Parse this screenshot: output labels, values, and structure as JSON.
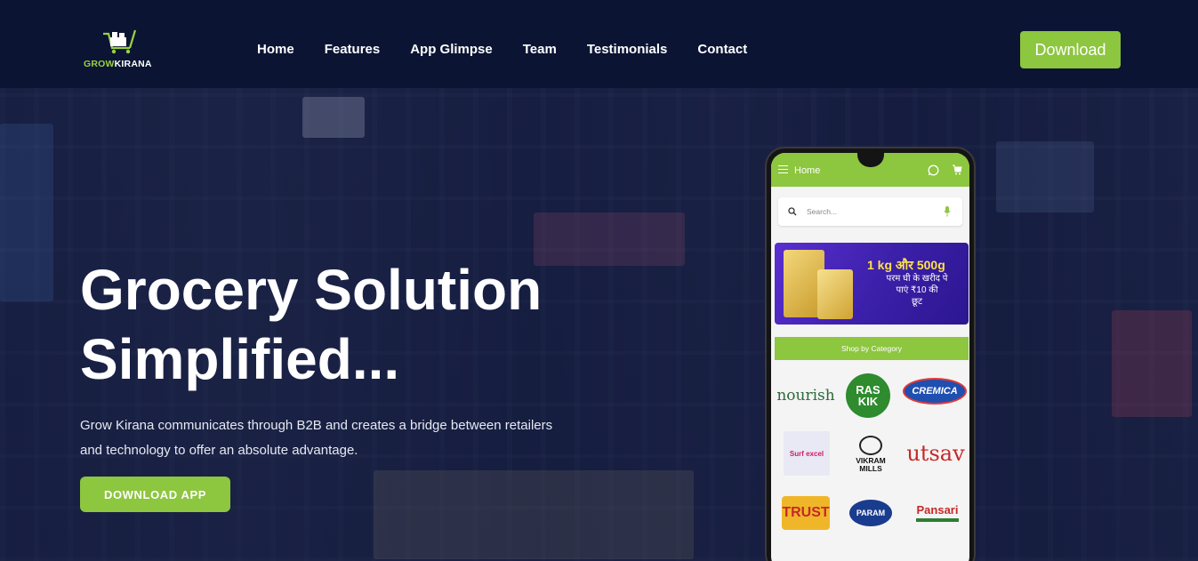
{
  "brand": {
    "logo_part1": "GROW",
    "logo_part2": "KIRANA"
  },
  "nav": {
    "links": [
      "Home",
      "Features",
      "App Glimpse",
      "Team",
      "Testimonials",
      "Contact"
    ],
    "download_label": "Download"
  },
  "hero": {
    "title_line1": "Grocery Solution",
    "title_line2": "Simplified...",
    "description_line1": "Grow Kirana communicates through B2B and creates a bridge between retailers",
    "description_line2": "and technology to offer an absolute advantage.",
    "cta_label": "DOWNLOAD APP"
  },
  "phone": {
    "app_bar_title": "Home",
    "search_placeholder": "Search...",
    "banner_line1": "1 kg और 500g",
    "banner_line2": "परम घी के खरीद पे",
    "banner_line3": "पाएं ₹10 की",
    "banner_line4": "छूट",
    "category_header": "Shop by Category",
    "brands": {
      "nourish": "nourish",
      "raskik_line1": "RAS",
      "raskik_line2": "KIK",
      "cremica": "CREMICA",
      "surf": "Surf excel",
      "vikram_line1": "VIKRAM",
      "vikram_line2": "MILLS",
      "utsav": "utsav",
      "trust": "TRUST",
      "param": "PARAM",
      "pansari": "Pansari"
    }
  },
  "colors": {
    "accent": "#8dc63f",
    "nav_bg": "#0b1433",
    "banner_bg": "#3a1fa8"
  }
}
